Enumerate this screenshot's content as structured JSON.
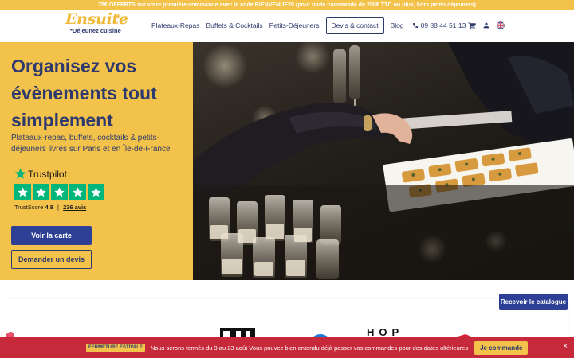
{
  "promo": {
    "text": "75€ OFFERTS sur votre première commande avec le code BIENVENUE20 (pour toute commande de 250€ TTC ou plus, hors petits déjeuners)"
  },
  "header": {
    "logo_main": "Ensuite",
    "logo_sub": "*Déjeunez cuisiné",
    "nav": [
      "Plateaux-Repas",
      "Buffets & Cocktails",
      "Petits-Déjeuners"
    ],
    "contact_button": "Devis & contact",
    "blog": "Blog",
    "phone": "09 88 44 51 13",
    "icons": [
      "cart-icon",
      "user-icon",
      "uk-flag-icon"
    ]
  },
  "hero": {
    "title": "Organisez vos évènements tout simplement",
    "subtitle": "Plateaux-repas, buffets, cocktails & petits-déjeuners livrés sur Paris et en Île-de-France",
    "trustpilot": {
      "brand": "Trustpilot",
      "score_label": "TrustScore",
      "score": "4.8",
      "separator": "|",
      "reviews": "236 avis",
      "stars": 5
    },
    "primary_button": "Voir la carte",
    "secondary_button": "Demander un devis"
  },
  "catalog_button": "Recevoir le catalogue",
  "press_logos": [
    "HOP"
  ],
  "banner": {
    "badge": "FERMETURE ESTIVALE",
    "text": "Nous serons fermés du 3 au 23 août   Vous pouvez bien entendu déjà passer vos commandes pour des dates ultérieures",
    "button": "Je commande",
    "close": "×"
  },
  "colors": {
    "brand_yellow": "#f3c24a",
    "brand_navy": "#2e3a6e",
    "button_blue": "#2e3f96",
    "trustpilot_green": "#00b67a",
    "banner_red": "#c6293a"
  }
}
